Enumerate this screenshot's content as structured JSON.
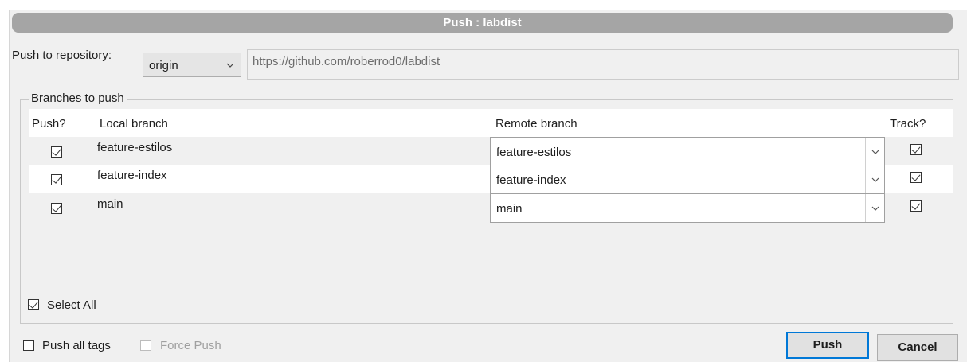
{
  "dialog": {
    "title": "Push :  labdist"
  },
  "repo": {
    "label": "Push to repository:",
    "selected": "origin",
    "url": "https://github.com/roberrod0/labdist"
  },
  "branches": {
    "legend": "Branches to push",
    "columns": {
      "push": "Push?",
      "local": "Local branch",
      "remote": "Remote branch",
      "track": "Track?"
    },
    "rows": [
      {
        "push": true,
        "local": "feature-estilos",
        "remote": "feature-estilos",
        "track": true
      },
      {
        "push": true,
        "local": "feature-index",
        "remote": "feature-index",
        "track": true
      },
      {
        "push": true,
        "local": "main",
        "remote": "main",
        "track": true
      }
    ],
    "select_all": {
      "label": "Select All",
      "checked": true
    }
  },
  "options": {
    "push_all_tags": {
      "label": "Push all tags",
      "checked": false
    },
    "force_push": {
      "label": "Force Push",
      "checked": false,
      "enabled": false
    }
  },
  "buttons": {
    "push": "Push",
    "cancel": "Cancel"
  },
  "icons": {
    "dropdown": "chevron-down-icon",
    "check": "checkmark-icon"
  }
}
